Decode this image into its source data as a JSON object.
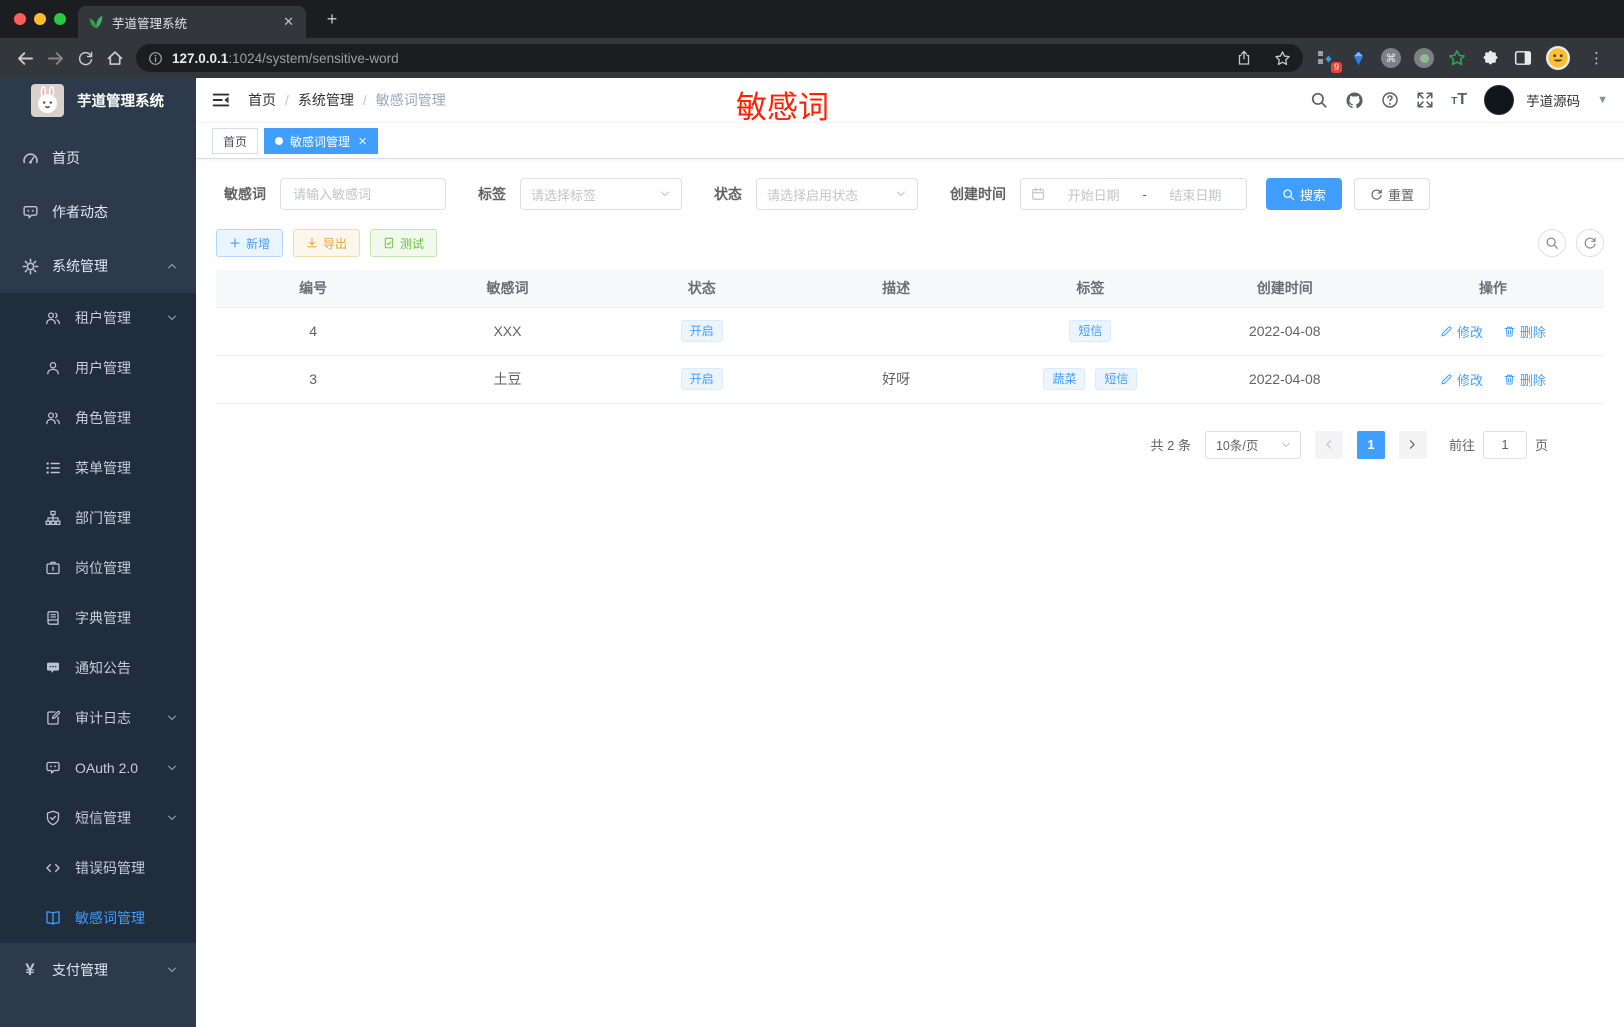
{
  "colors": {
    "accent": "#409eff",
    "success": "#67c23a",
    "warning": "#e6a23c",
    "annotation_red": "#ff2000",
    "sidebar_bg": "#2d3a4b",
    "sidebar_submenu_bg": "#1f2d3d",
    "active_tag_bg": "#409eff"
  },
  "browser": {
    "tab_title": "芋道管理系统",
    "new_tab_label": "+",
    "url_host": "127.0.0.1",
    "url_rest": ":1024/system/sensitive-word",
    "extension_badge": "9"
  },
  "app": {
    "logo_title": "芋道管理系统",
    "breadcrumb": [
      "首页",
      "系统管理",
      "敏感词管理"
    ],
    "breadcrumb_sep": "/",
    "annotation": "敏感词",
    "user_name": "芋道源码"
  },
  "sidebar": {
    "items": [
      {
        "label": "首页"
      },
      {
        "label": "作者动态"
      },
      {
        "label": "系统管理"
      },
      {
        "label": "租户管理"
      },
      {
        "label": "用户管理"
      },
      {
        "label": "角色管理"
      },
      {
        "label": "菜单管理"
      },
      {
        "label": "部门管理"
      },
      {
        "label": "岗位管理"
      },
      {
        "label": "字典管理"
      },
      {
        "label": "通知公告"
      },
      {
        "label": "审计日志"
      },
      {
        "label": "OAuth 2.0"
      },
      {
        "label": "短信管理"
      },
      {
        "label": "错误码管理"
      },
      {
        "label": "敏感词管理"
      },
      {
        "label": "支付管理"
      }
    ]
  },
  "tags": {
    "home": "首页",
    "active": "敏感词管理"
  },
  "filter": {
    "keyword_label": "敏感词",
    "keyword_placeholder": "请输入敏感词",
    "tag_label": "标签",
    "tag_placeholder": "请选择标签",
    "status_label": "状态",
    "status_placeholder": "请选择启用状态",
    "date_label": "创建时间",
    "date_start": "开始日期",
    "date_separator": "-",
    "date_end": "结束日期",
    "search_label": "搜索",
    "reset_label": "重置"
  },
  "toolbar": {
    "add_label": "新增",
    "export_label": "导出",
    "test_label": "测试"
  },
  "table": {
    "headers": [
      "编号",
      "敏感词",
      "状态",
      "描述",
      "标签",
      "创建时间",
      "操作"
    ],
    "rows": [
      {
        "id": "4",
        "word": "XXX",
        "status": "开启",
        "desc": "",
        "tags": [
          "短信"
        ],
        "created": "2022-04-08",
        "edit_label": "修改",
        "delete_label": "删除"
      },
      {
        "id": "3",
        "word": "土豆",
        "status": "开启",
        "desc": "好呀",
        "tags": [
          "蔬菜",
          "短信"
        ],
        "created": "2022-04-08",
        "edit_label": "修改",
        "delete_label": "删除"
      }
    ]
  },
  "pagination": {
    "total": "共 2 条",
    "page_size": "10条/页",
    "page": "1",
    "goto_label": "前往",
    "goto_value": "1",
    "unit_label": "页"
  }
}
